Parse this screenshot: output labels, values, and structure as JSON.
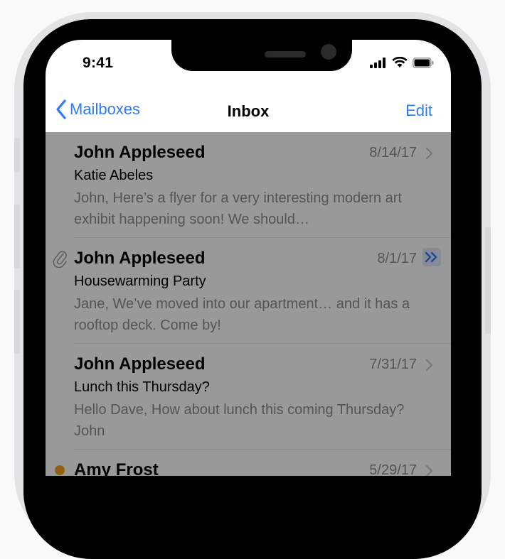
{
  "status_bar": {
    "time": "9:41"
  },
  "nav": {
    "back_label": "Mailboxes",
    "title": "Inbox",
    "edit_label": "Edit"
  },
  "messages": [
    {
      "sender": "John Appleseed",
      "date": "8/14/17",
      "subject": "Katie Abeles",
      "preview": "John, Here’s a flyer for a very interesting modern art exhibit happening soon! We should…",
      "attachment": false,
      "forwarded": false,
      "unread": false
    },
    {
      "sender": "John Appleseed",
      "date": "8/1/17",
      "subject": "Housewarming Party",
      "preview": "Jane, We’ve moved into our apartment… and it has a rooftop deck. Come by!",
      "attachment": true,
      "forwarded": true,
      "unread": false
    },
    {
      "sender": "John Appleseed",
      "date": "7/31/17",
      "subject": "Lunch this Thursday?",
      "preview": "Hello Dave, How about lunch this coming Thursday? John",
      "attachment": false,
      "forwarded": false,
      "unread": false
    },
    {
      "sender": "Amy Frost",
      "date": "5/29/17",
      "subject": "",
      "preview": "",
      "attachment": false,
      "forwarded": false,
      "unread": true
    }
  ],
  "colors": {
    "accent": "#2f7bf6",
    "unread_dot": "#f5a020",
    "overlay": "rgba(0,0,0,0.40)"
  },
  "icons": {
    "signal": "cellular-signal-icon",
    "wifi": "wifi-icon",
    "battery": "battery-icon",
    "back": "chevron-left-icon",
    "disclosure": "chevron-right-icon",
    "attachment": "paperclip-icon",
    "forwarded": "double-chevron-icon"
  }
}
